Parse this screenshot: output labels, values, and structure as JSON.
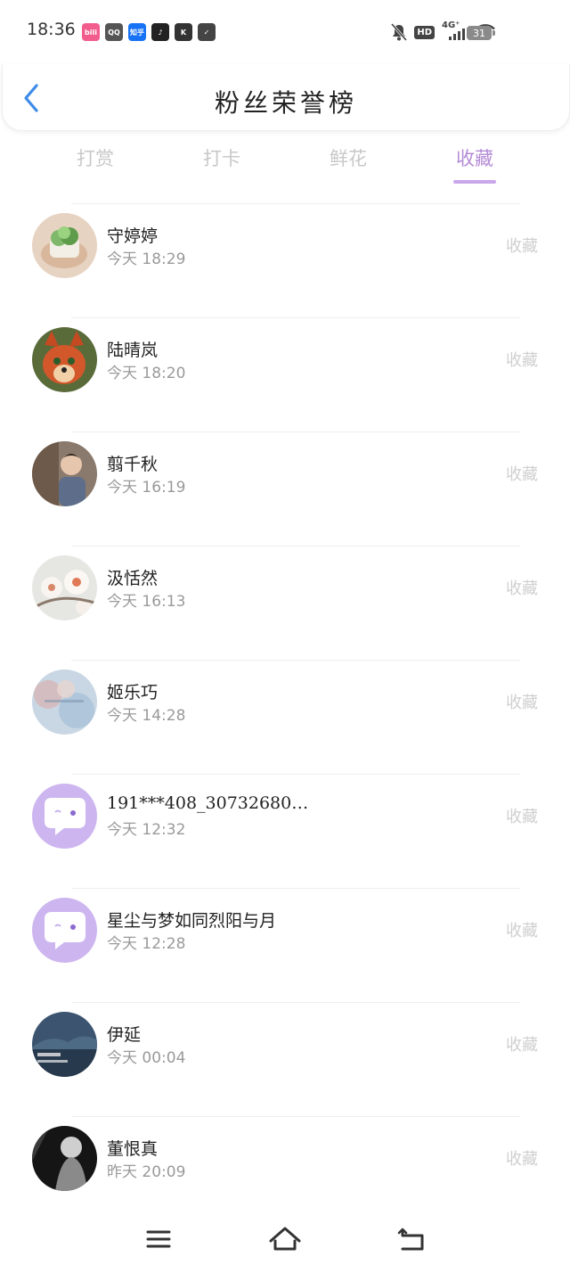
{
  "status_bar": {
    "time": "18:36",
    "notification_icons": [
      {
        "name": "bilibili-icon",
        "label": "bili",
        "color": "#f25d8e"
      },
      {
        "name": "qq-icon",
        "label": "QQ",
        "color": "#555555"
      },
      {
        "name": "zhihu-icon",
        "label": "知乎",
        "color": "#1772f6"
      },
      {
        "name": "tiktok-icon",
        "label": "♪",
        "color": "#222222"
      },
      {
        "name": "kuaishou-icon",
        "label": "K",
        "color": "#333333"
      },
      {
        "name": "shield-icon",
        "label": "✓",
        "color": "#444444"
      }
    ],
    "network": "4G⁺",
    "hd_badge": "HD",
    "battery": "31"
  },
  "header": {
    "title": "粉丝荣誉榜",
    "back_icon": "chevron-left-icon",
    "accent_color": "#3d8be8"
  },
  "tabs": [
    {
      "label": "打赏",
      "active": false
    },
    {
      "label": "打卡",
      "active": false
    },
    {
      "label": "鲜花",
      "active": false
    },
    {
      "label": "收藏",
      "active": true
    }
  ],
  "fans": [
    {
      "name": "守婷婷",
      "time": "今天 18:29",
      "action": "收藏",
      "avatar": "plant"
    },
    {
      "name": "陆晴岚",
      "time": "今天 18:20",
      "action": "收藏",
      "avatar": "fox"
    },
    {
      "name": "翦千秋",
      "time": "今天 16:19",
      "action": "收藏",
      "avatar": "person"
    },
    {
      "name": "汲恬然",
      "time": "今天 16:13",
      "action": "收藏",
      "avatar": "flower"
    },
    {
      "name": "姬乐巧",
      "time": "今天 14:28",
      "action": "收藏",
      "avatar": "bokeh"
    },
    {
      "name": "191***408_30732680…",
      "time": "今天 12:32",
      "action": "收藏",
      "avatar": "default"
    },
    {
      "name": "星尘与梦如同烈阳与月",
      "time": "今天 12:28",
      "action": "收藏",
      "avatar": "default"
    },
    {
      "name": "伊延",
      "time": "今天 00:04",
      "action": "收藏",
      "avatar": "scenery"
    },
    {
      "name": "董恨真",
      "time": "昨天 20:09",
      "action": "收藏",
      "avatar": "bw"
    }
  ],
  "nav_bar": {
    "menu_icon": "menu-icon",
    "home_icon": "home-icon",
    "back_icon": "back-icon"
  }
}
